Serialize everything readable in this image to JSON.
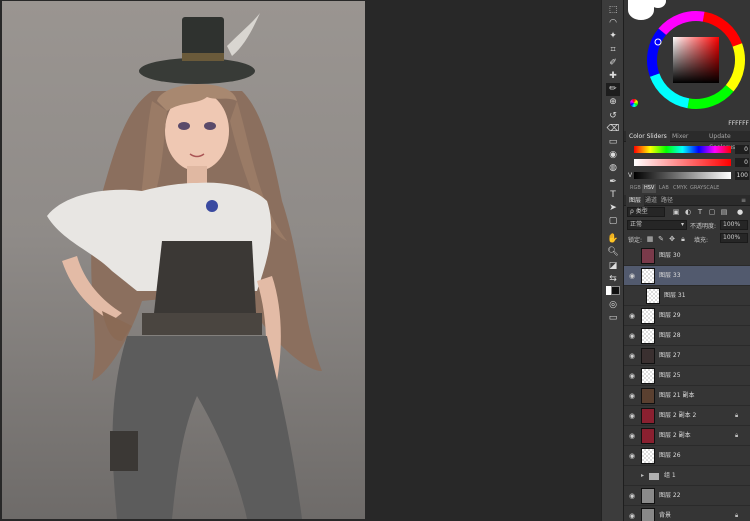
{
  "tools": [
    "marquee-tool",
    "lasso-tool",
    "magic-wand-tool",
    "crop-tool",
    "eyedropper-tool",
    "healing-tool",
    "brush-tool",
    "clone-stamp-tool",
    "history-brush-tool",
    "eraser-tool",
    "gradient-tool",
    "blur-tool",
    "dodge-tool",
    "pen-tool",
    "type-tool",
    "path-select-tool",
    "shape-tool",
    "hand-tool",
    "zoom-tool",
    "default-colors",
    "swap-colors",
    "foreground-color",
    "background-color",
    "quick-mask",
    "screen-mode"
  ],
  "color_wheel": {
    "hex_value": "FFFFFF",
    "foreground": "#ffffff",
    "background": "#000000"
  },
  "color_tabs": [
    "Color Sliders",
    "Mixer",
    "Update Coolorus"
  ],
  "sliders": [
    {
      "label": "",
      "value": "0"
    },
    {
      "label": "",
      "value": "0"
    },
    {
      "label": "V",
      "value": "100"
    }
  ],
  "modes": [
    "RGB",
    "HSV",
    "LAB",
    "CMYK",
    "GRAYSCALE"
  ],
  "layers_tabs": [
    "图层",
    "通道",
    "路径"
  ],
  "layers_panel": {
    "filter_label": "ρ 类型",
    "blend_mode": "正常",
    "opacity_label": "不透明度:",
    "opacity_value": "100%",
    "lock_label": "锁定:",
    "fill_label": "填充:",
    "fill_value": "100%"
  },
  "layers": [
    {
      "name": "图层 30",
      "visible": false,
      "selected": false,
      "locked": false,
      "thumb": "#7a3a4a",
      "indent": false
    },
    {
      "name": "图层 33",
      "visible": true,
      "selected": true,
      "locked": false,
      "thumb": "",
      "indent": false
    },
    {
      "name": "图层 31",
      "visible": false,
      "selected": false,
      "locked": false,
      "thumb": "",
      "indent": true
    },
    {
      "name": "图层 29",
      "visible": true,
      "selected": false,
      "locked": false,
      "thumb": "",
      "indent": false
    },
    {
      "name": "图层 28",
      "visible": true,
      "selected": false,
      "locked": false,
      "thumb": "",
      "indent": false
    },
    {
      "name": "图层 27",
      "visible": true,
      "selected": false,
      "locked": false,
      "thumb": "#3a3030",
      "indent": false
    },
    {
      "name": "图层 25",
      "visible": true,
      "selected": false,
      "locked": false,
      "thumb": "",
      "indent": false
    },
    {
      "name": "图层 21 副本",
      "visible": true,
      "selected": false,
      "locked": false,
      "thumb": "#5a4030",
      "indent": false
    },
    {
      "name": "图层 2 副本 2",
      "visible": true,
      "selected": false,
      "locked": true,
      "thumb": "#8a2030",
      "indent": false
    },
    {
      "name": "图层 2 副本",
      "visible": true,
      "selected": false,
      "locked": true,
      "thumb": "#8a2030",
      "indent": false
    },
    {
      "name": "图层 26",
      "visible": true,
      "selected": false,
      "locked": false,
      "thumb": "",
      "indent": false
    },
    {
      "name": "组 1",
      "visible": false,
      "selected": false,
      "locked": false,
      "thumb": "folder",
      "indent": false
    },
    {
      "name": "图层 22",
      "visible": true,
      "selected": false,
      "locked": false,
      "thumb": "#8a8a8a",
      "indent": false
    },
    {
      "name": "背景",
      "visible": true,
      "selected": false,
      "locked": true,
      "thumb": "#888888",
      "indent": false
    }
  ]
}
